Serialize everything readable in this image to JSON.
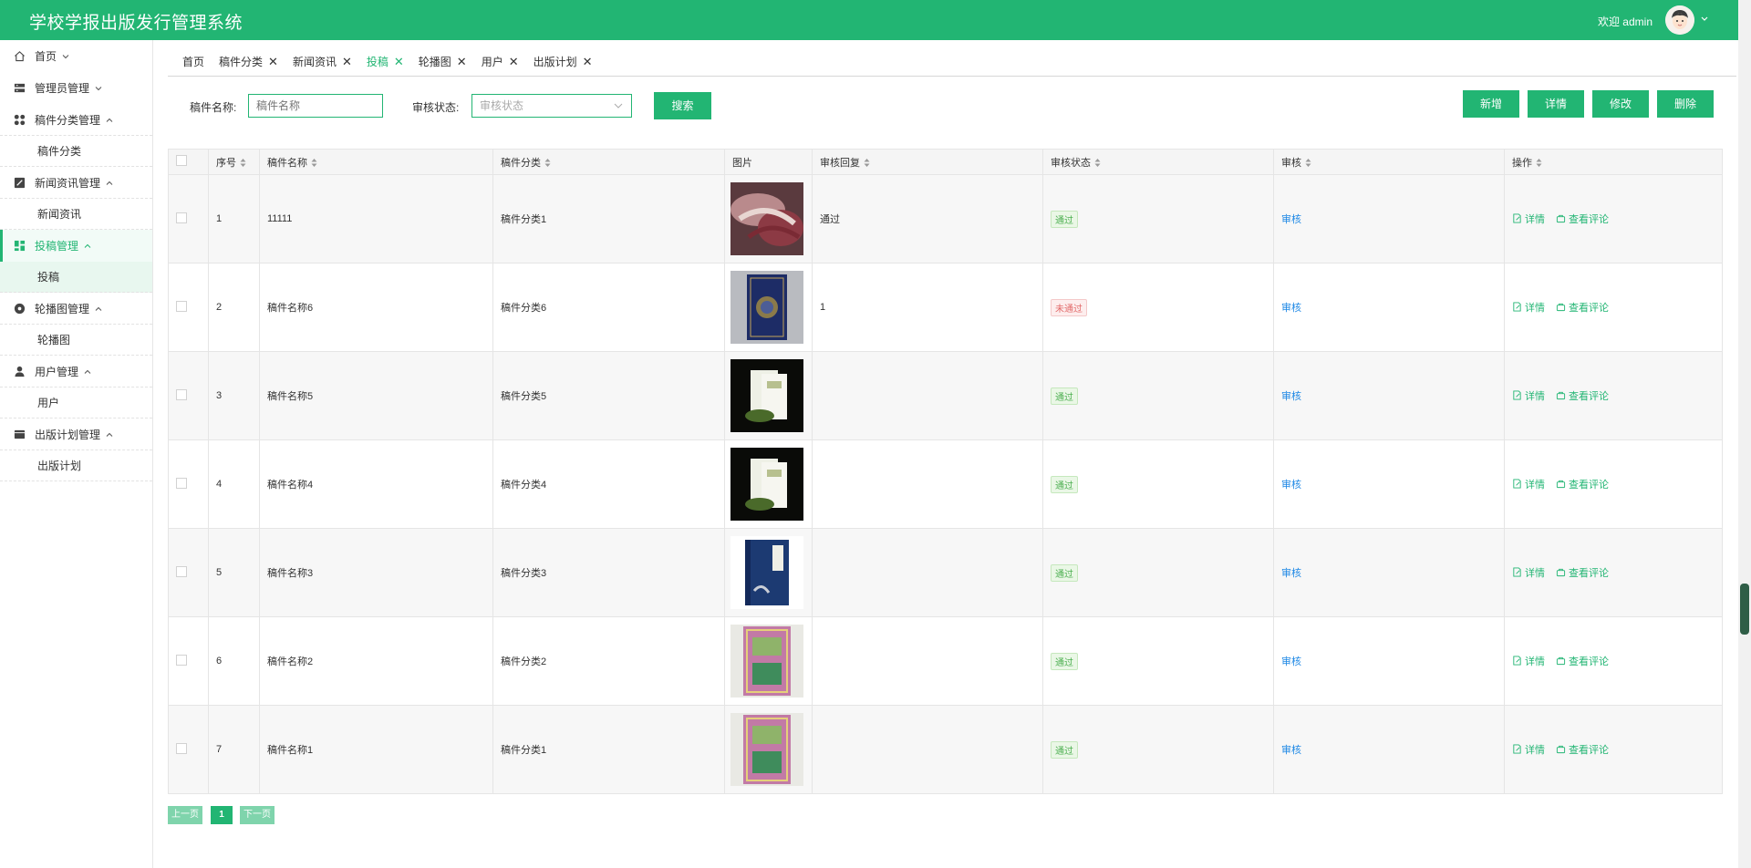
{
  "header": {
    "title": "学校学报出版发行管理系统",
    "welcome": "欢迎 admin"
  },
  "sidebar": {
    "items": [
      {
        "label": "首页",
        "icon": "home-icon"
      },
      {
        "label": "管理员管理",
        "icon": "admin-icon"
      },
      {
        "label": "稿件分类管理",
        "icon": "category-icon",
        "sub": "稿件分类"
      },
      {
        "label": "新闻资讯管理",
        "icon": "news-icon",
        "sub": "新闻资讯"
      },
      {
        "label": "投稿管理",
        "icon": "dashboard-icon",
        "sub": "投稿"
      },
      {
        "label": "轮播图管理",
        "icon": "carousel-icon",
        "sub": "轮播图"
      },
      {
        "label": "用户管理",
        "icon": "user-icon",
        "sub": "用户"
      },
      {
        "label": "出版计划管理",
        "icon": "plan-icon",
        "sub": "出版计划"
      }
    ]
  },
  "tabs": [
    {
      "label": "首页",
      "closable": false
    },
    {
      "label": "稿件分类",
      "closable": true
    },
    {
      "label": "新闻资讯",
      "closable": true
    },
    {
      "label": "投稿",
      "closable": true,
      "active": true
    },
    {
      "label": "轮播图",
      "closable": true
    },
    {
      "label": "用户",
      "closable": true
    },
    {
      "label": "出版计划",
      "closable": true
    }
  ],
  "search": {
    "name_label": "稿件名称:",
    "name_placeholder": "稿件名称",
    "status_label": "审核状态:",
    "status_placeholder": "审核状态",
    "search_button": "搜索"
  },
  "toolbar": {
    "add": "新增",
    "detail": "详情",
    "edit": "修改",
    "delete": "删除"
  },
  "table": {
    "columns": [
      "序号",
      "稿件名称",
      "稿件分类",
      "图片",
      "审核回复",
      "审核状态",
      "审核",
      "操作"
    ],
    "rows": [
      {
        "no": "1",
        "name": "11111",
        "category": "稿件分类1",
        "reply": "通过",
        "status": "通过",
        "status_ok": true
      },
      {
        "no": "2",
        "name": "稿件名称6",
        "category": "稿件分类6",
        "reply": "1",
        "status": "未通过",
        "status_ok": false
      },
      {
        "no": "3",
        "name": "稿件名称5",
        "category": "稿件分类5",
        "reply": "",
        "status": "通过",
        "status_ok": true
      },
      {
        "no": "4",
        "name": "稿件名称4",
        "category": "稿件分类4",
        "reply": "",
        "status": "通过",
        "status_ok": true
      },
      {
        "no": "5",
        "name": "稿件名称3",
        "category": "稿件分类3",
        "reply": "",
        "status": "通过",
        "status_ok": true
      },
      {
        "no": "6",
        "name": "稿件名称2",
        "category": "稿件分类2",
        "reply": "",
        "status": "通过",
        "status_ok": true
      },
      {
        "no": "7",
        "name": "稿件名称1",
        "category": "稿件分类1",
        "reply": "",
        "status": "通过",
        "status_ok": true
      }
    ],
    "audit_link": "审核",
    "op_detail": "详情",
    "op_comments": "查看评论"
  },
  "pagination": {
    "prev": "上一页",
    "current": "1",
    "next": "下一页"
  },
  "colors": {
    "primary": "#22b573",
    "link": "#1e88e5"
  }
}
